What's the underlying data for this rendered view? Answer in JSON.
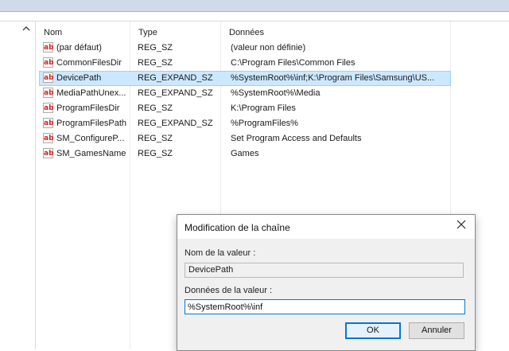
{
  "columns": {
    "name": "Nom",
    "type": "Type",
    "data": "Données"
  },
  "rows": [
    {
      "icon": "ab",
      "name": "(par défaut)",
      "type": "REG_SZ",
      "data": "(valeur non définie)"
    },
    {
      "icon": "ab",
      "name": "CommonFilesDir",
      "type": "REG_SZ",
      "data": "C:\\Program Files\\Common Files"
    },
    {
      "icon": "ab",
      "name": "DevicePath",
      "type": "REG_EXPAND_SZ",
      "data": "%SystemRoot%\\inf;K:\\Program Files\\Samsung\\US..."
    },
    {
      "icon": "ab",
      "name": "MediaPathUnex...",
      "type": "REG_EXPAND_SZ",
      "data": "%SystemRoot%\\Media"
    },
    {
      "icon": "ab",
      "name": "ProgramFilesDir",
      "type": "REG_SZ",
      "data": "K:\\Program Files"
    },
    {
      "icon": "ab",
      "name": "ProgramFilesPath",
      "type": "REG_EXPAND_SZ",
      "data": "%ProgramFiles%"
    },
    {
      "icon": "ab",
      "name": "SM_ConfigureP...",
      "type": "REG_SZ",
      "data": "Set Program Access and Defaults"
    },
    {
      "icon": "ab",
      "name": "SM_GamesName",
      "type": "REG_SZ",
      "data": "Games"
    }
  ],
  "selected_row": "DevicePath",
  "dialog": {
    "title": "Modification de la chaîne",
    "close_icon": "close-icon",
    "value_name_label": "Nom de la valeur :",
    "value_name": "DevicePath",
    "value_data_label": "Données de la valeur :",
    "value_data": "%SystemRoot%\\inf",
    "ok_label": "OK",
    "cancel_label": "Annuler"
  },
  "colors": {
    "selection": "#cce8ff",
    "accent": "#0078d7",
    "icon_text": "#cc2222"
  }
}
